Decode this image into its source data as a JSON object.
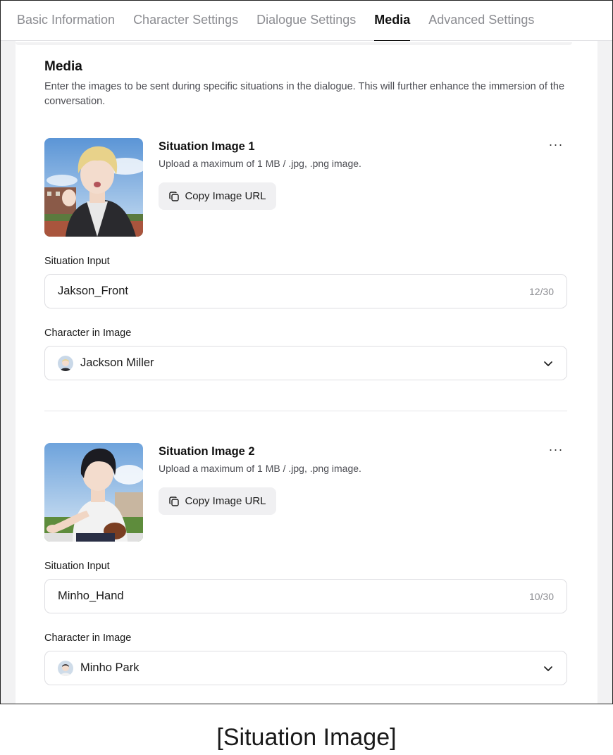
{
  "tabs": [
    {
      "label": "Basic Information",
      "active": false
    },
    {
      "label": "Character Settings",
      "active": false
    },
    {
      "label": "Dialogue Settings",
      "active": false
    },
    {
      "label": "Media",
      "active": true
    },
    {
      "label": "Advanced Settings",
      "active": false
    }
  ],
  "section": {
    "title": "Media",
    "description": "Enter the images to be sent during specific situations in the dialogue. This will further enhance the immersion of the conversation."
  },
  "items": [
    {
      "title": "Situation Image 1",
      "note": "Upload a maximum of 1 MB / .jpg, .png image.",
      "copy_label": "Copy Image URL",
      "more_label": "···",
      "situation_label": "Situation Input",
      "situation_value": "Jakson_Front",
      "situation_count": "12/30",
      "character_label": "Character in Image",
      "character_value": "Jackson Miller",
      "hair_color": "#e8d28a",
      "shirt_color": "#2a2a2e"
    },
    {
      "title": "Situation Image 2",
      "note": "Upload a maximum of 1 MB / .jpg, .png image.",
      "copy_label": "Copy Image URL",
      "more_label": "···",
      "situation_label": "Situation Input",
      "situation_value": "Minho_Hand",
      "situation_count": "10/30",
      "character_label": "Character in Image",
      "character_value": "Minho Park",
      "hair_color": "#1c1c22",
      "shirt_color": "#f2f2f2"
    }
  ],
  "caption": "[Situation Image]",
  "colors": {
    "active_tab": "#111111",
    "inactive_tab": "#8b8c91",
    "border": "#dedee2",
    "button_bg": "#f0f0f2"
  }
}
